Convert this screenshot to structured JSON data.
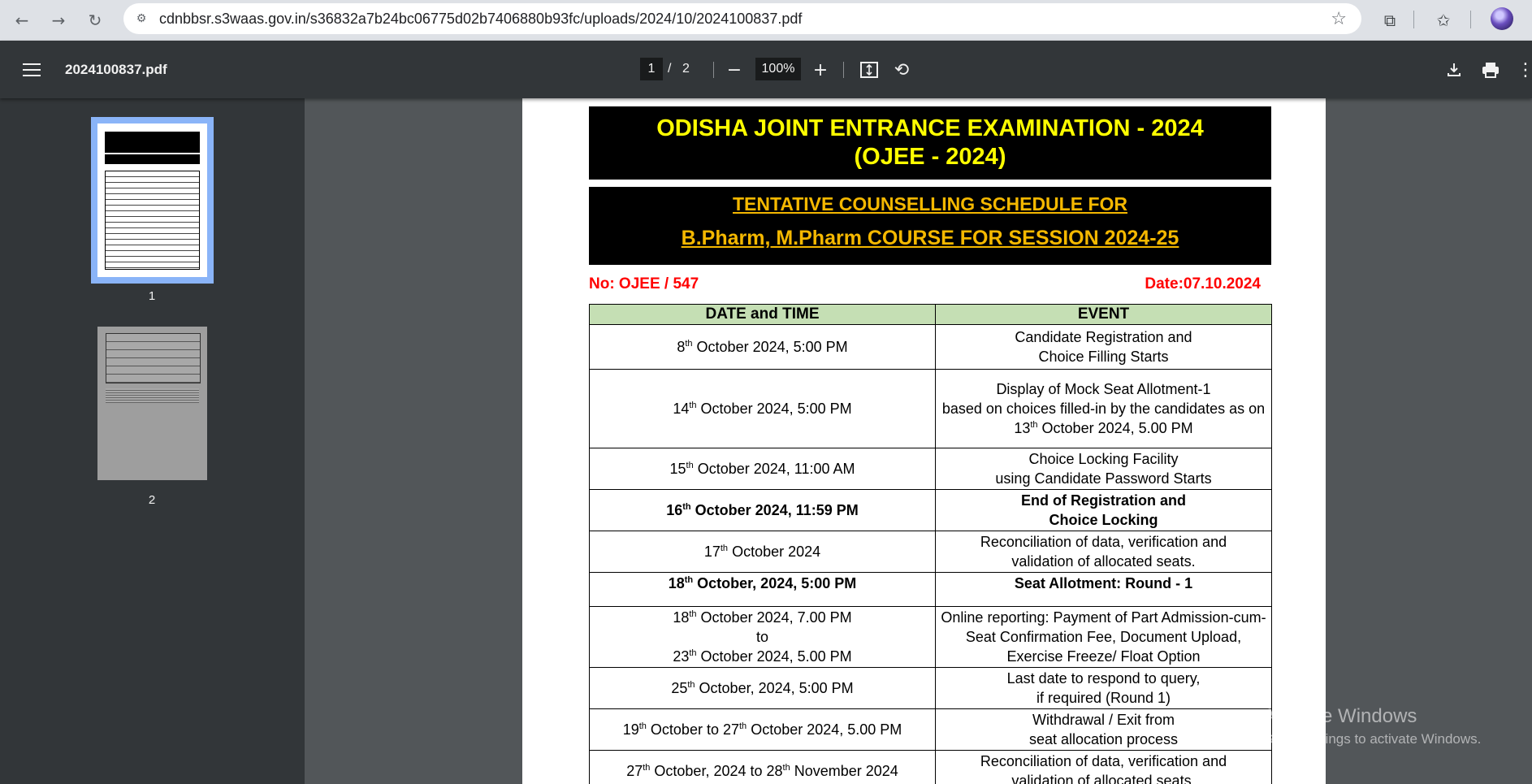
{
  "browser": {
    "url": "cdnbbsr.s3waas.gov.in/s36832a7b24bc06775d02b7406880b93fc/uploads/2024/10/2024100837.pdf",
    "icons": [
      "back-arrow-icon",
      "forward-arrow-icon",
      "reload-icon",
      "site-info-icon",
      "bookmark-star-icon",
      "extensions-icon",
      "bookmarks-icon",
      "profile-avatar"
    ]
  },
  "pdf_toolbar": {
    "filename": "2024100837.pdf",
    "current_page": "1",
    "page_separator": "/",
    "total_pages": "2",
    "zoom": "100%"
  },
  "thumbnails": [
    {
      "label": "1"
    },
    {
      "label": "2"
    }
  ],
  "document": {
    "title_line1": "ODISHA JOINT ENTRANCE EXAMINATION - 2024",
    "title_line2": "(OJEE - 2024)",
    "subtitle_line1": "TENTATIVE  COUNSELLING SCHEDULE  FOR",
    "subtitle_line2": "B.Pharm, M.Pharm COURSE FOR SESSION 2024-25",
    "ref_no": "No: OJEE / 547",
    "date": "Date:07.10.2024",
    "table_headers": [
      "DATE and TIME",
      "EVENT"
    ]
  },
  "watermark": {
    "line1": "Activate Windows",
    "line2": "Go to Settings to activate Windows."
  },
  "colors": {
    "title_yellow": "#ffff00",
    "subtitle_orange": "#f5b800",
    "ref_red": "#ff0000",
    "header_green": "#c5dfb4"
  }
}
